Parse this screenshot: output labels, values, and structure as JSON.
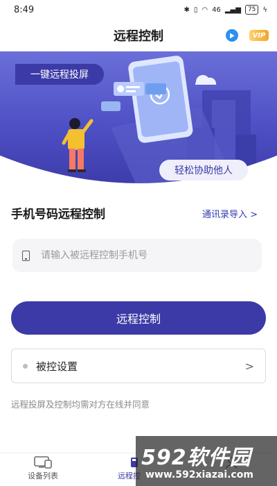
{
  "status_bar": {
    "time": "8:49",
    "network": "46",
    "battery": "75"
  },
  "nav": {
    "title": "远程控制",
    "vip_label": "VIP"
  },
  "banner": {
    "tag": "一键远程投屏",
    "pill": "轻松协助他人"
  },
  "section": {
    "title": "手机号码远程控制",
    "import_link": "通讯录导入 >"
  },
  "phone_input": {
    "placeholder": "请输入被远程控制手机号",
    "value": ""
  },
  "primary_button": {
    "label": "远程控制"
  },
  "settings": {
    "label": "被控设置",
    "chevron": ">"
  },
  "notice": "远程投屏及控制均需对方在线并同意",
  "tabs": [
    {
      "label": "设备列表",
      "icon": "monitor-phone-icon",
      "active": false
    },
    {
      "label": "远程控",
      "icon": "remote-control-icon",
      "active": true
    },
    {
      "label": "",
      "icon": "user-icon",
      "active": false
    }
  ],
  "watermark": {
    "brand": "592软件园",
    "url": "www.592xiazai.com"
  },
  "colors": {
    "accent": "#3b3aa6",
    "banner_top": "#6b6fd8",
    "banner_bottom": "#3c3aa8",
    "link": "#2f3ab0"
  }
}
